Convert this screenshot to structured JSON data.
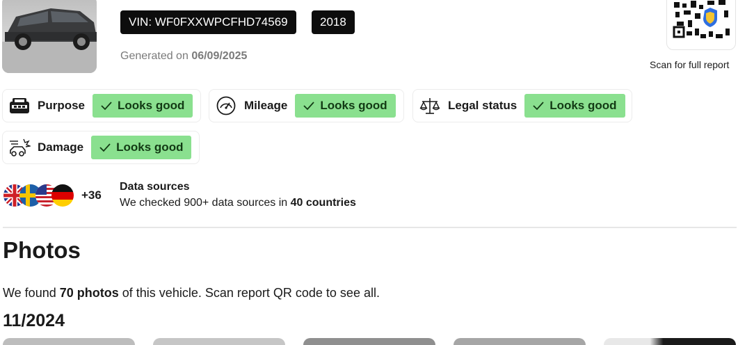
{
  "header": {
    "vin_label": "VIN: WF0FXXWPCFHD74569",
    "year": "2018",
    "generated_prefix": "Generated on",
    "generated_date": "06/09/2025"
  },
  "qr": {
    "caption": "Scan for full report"
  },
  "checks": [
    {
      "label": "Purpose",
      "status": "Looks good",
      "icon": "taxi-car-icon"
    },
    {
      "label": "Mileage",
      "status": "Looks good",
      "icon": "speedometer-icon"
    },
    {
      "label": "Legal status",
      "status": "Looks good",
      "icon": "scales-icon"
    },
    {
      "label": "Damage",
      "status": "Looks good",
      "icon": "car-crash-icon"
    }
  ],
  "data_sources": {
    "extra_count": "+36",
    "title": "Data sources",
    "text_prefix": "We checked 900+ data sources in",
    "text_bold": "40 countries",
    "flags": [
      "uk-flag-icon",
      "sweden-flag-icon",
      "usa-flag-icon",
      "germany-flag-icon"
    ]
  },
  "photos": {
    "heading": "Photos",
    "text_prefix": "We found",
    "text_bold": "70 photos",
    "text_suffix": "of this vehicle. Scan report QR code to see all.",
    "date_heading": "11/2024"
  },
  "colors": {
    "status_good": "#8ae08f",
    "badge_bg": "#0d0d0d"
  }
}
